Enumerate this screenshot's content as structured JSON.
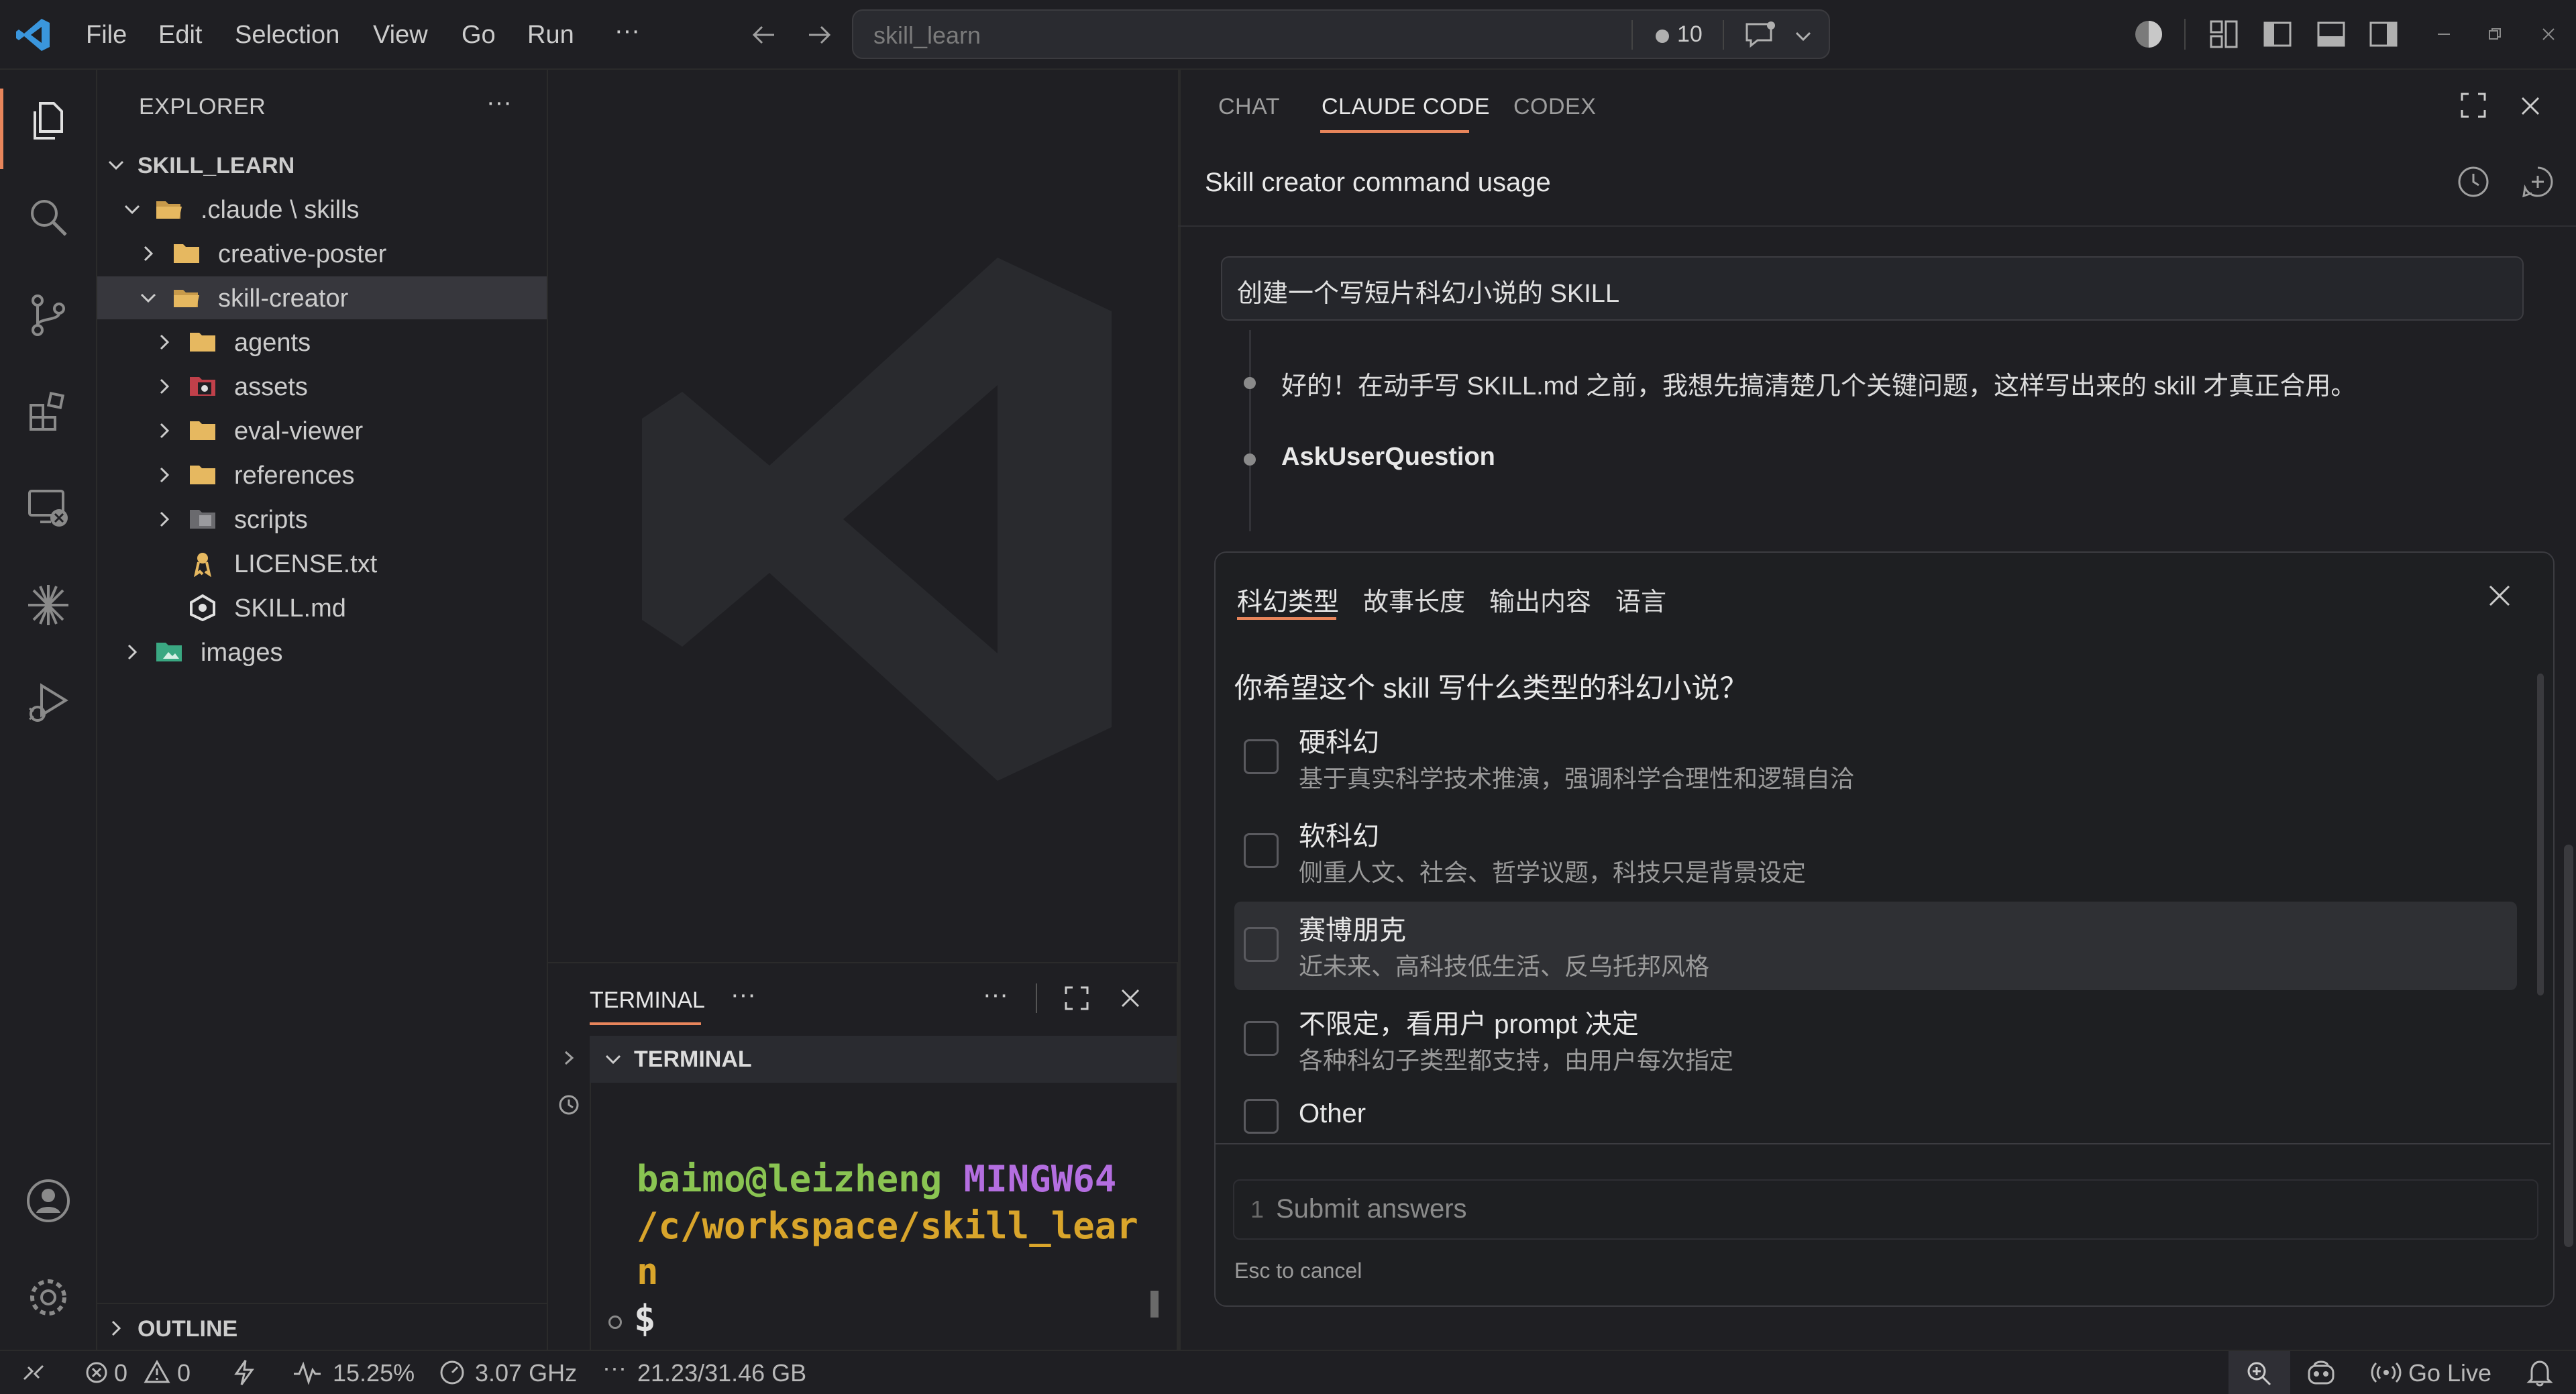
{
  "menu": {
    "file": "File",
    "edit": "Edit",
    "selection": "Selection",
    "view": "View",
    "go": "Go",
    "run": "Run",
    "more": "···"
  },
  "search": {
    "placeholder": "skill_learn",
    "badge_count": "10"
  },
  "explorer": {
    "title": "EXPLORER",
    "more": "···",
    "root": "SKILL_LEARN",
    "items": [
      {
        "label": ".claude \\ skills"
      },
      {
        "label": "creative-poster"
      },
      {
        "label": "skill-creator"
      },
      {
        "label": "agents"
      },
      {
        "label": "assets"
      },
      {
        "label": "eval-viewer"
      },
      {
        "label": "references"
      },
      {
        "label": "scripts"
      },
      {
        "label": "LICENSE.txt"
      },
      {
        "label": "SKILL.md"
      },
      {
        "label": "images"
      }
    ],
    "outline": "OUTLINE"
  },
  "terminal": {
    "tab": "TERMINAL",
    "tab_more": "···",
    "more": "···",
    "section": "TERMINAL",
    "user": "baimo@leizheng",
    "shell": "MINGW64",
    "path_line1": "/c/workspace/skill_lear",
    "path_line2": "n",
    "prompt": "$"
  },
  "chat": {
    "tabs": [
      "CHAT",
      "CLAUDE CODE",
      "CODEX"
    ],
    "title": "Skill creator command usage",
    "user_message": "创建一个写短片科幻小说的 SKILL",
    "assistant_message": "好的！在动手写 SKILL.md 之前，我想先搞清楚几个关键问题，这样写出来的 skill 才真正合用。",
    "tool_name": "AskUserQuestion",
    "question_tabs": [
      "科幻类型",
      "故事长度",
      "输出内容",
      "语言"
    ],
    "question": "你希望这个 skill 写什么类型的科幻小说？",
    "options": [
      {
        "label": "硬科幻",
        "desc": "基于真实科学技术推演，强调科学合理性和逻辑自洽"
      },
      {
        "label": "软科幻",
        "desc": "侧重人文、社会、哲学议题，科技只是背景设定"
      },
      {
        "label": "赛博朋克",
        "desc": "近未来、高科技低生活、反乌托邦风格"
      },
      {
        "label": "不限定，看用户 prompt 决定",
        "desc": "各种科幻子类型都支持，由用户每次指定"
      },
      {
        "label": "Other",
        "desc": ""
      }
    ],
    "submit_num": "1",
    "submit_label": "Submit answers",
    "esc_hint": "Esc to cancel"
  },
  "status": {
    "errors": "0",
    "warnings": "0",
    "cpu": "15.25%",
    "freq": "3.07 GHz",
    "mem": "21.23/31.46 GB",
    "golive": "Go Live"
  },
  "colors": {
    "accent": "#e8855b",
    "vscode_blue": "#3a96dd",
    "term_green": "#8ac452",
    "term_purple": "#b46ee0",
    "term_yellow": "#d9a52b"
  }
}
